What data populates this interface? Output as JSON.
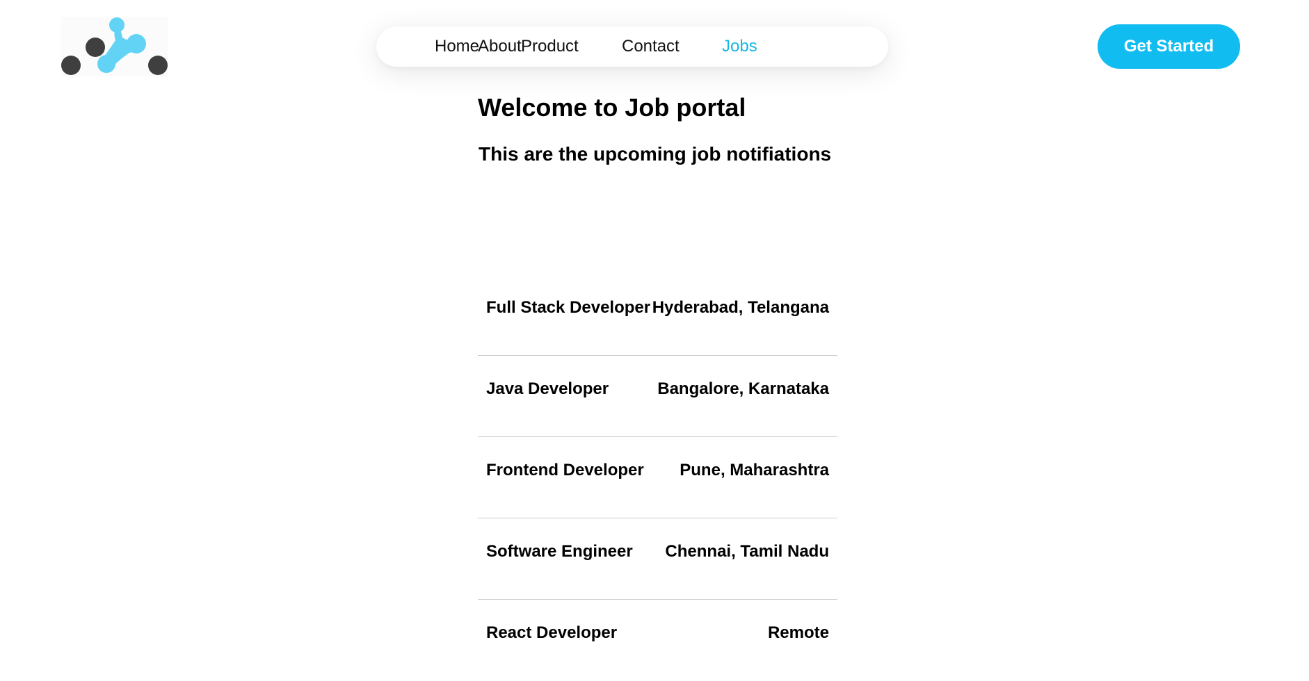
{
  "header": {
    "logo_name": "brand-logo",
    "nav": [
      {
        "label": "Home",
        "active": false
      },
      {
        "label": "About",
        "active": false
      },
      {
        "label": "Product",
        "active": false
      },
      {
        "label": "Contact",
        "active": false
      },
      {
        "label": "Jobs",
        "active": true
      }
    ],
    "cta_label": "Get Started"
  },
  "main": {
    "title": "Welcome to Job portal",
    "subtitle": "This are the upcoming job notifiations",
    "jobs": [
      {
        "title": "Full Stack Developer",
        "location": "Hyderabad, Telangana"
      },
      {
        "title": "Java Developer",
        "location": "Bangalore, Karnataka"
      },
      {
        "title": "Frontend Developer",
        "location": "Pune, Maharashtra"
      },
      {
        "title": "Software Engineer",
        "location": "Chennai, Tamil Nadu"
      },
      {
        "title": "React Developer",
        "location": "Remote"
      }
    ]
  },
  "colors": {
    "accent": "#10bcf0",
    "active_nav": "#14b8e6",
    "logo_dark": "#3f3f3f",
    "logo_light": "#63d3f5",
    "divider": "#cccccc"
  }
}
